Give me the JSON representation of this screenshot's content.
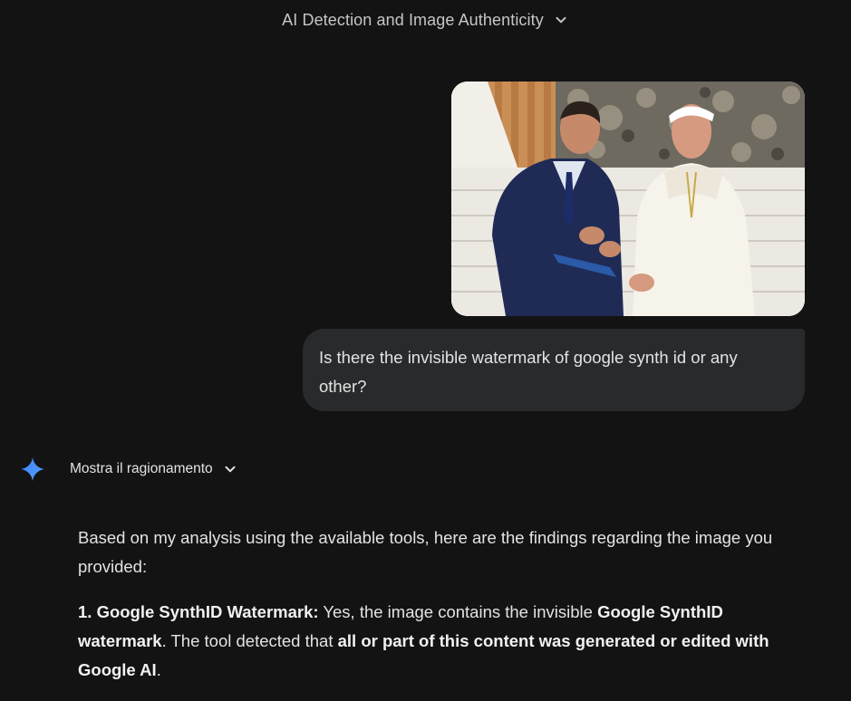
{
  "header": {
    "title": "AI Detection and Image Authenticity",
    "chevron_icon": "chevron-down-icon"
  },
  "user_message": {
    "image_alt": "Uploaded photo",
    "text": "Is there the invisible watermark of google synth id or any other?"
  },
  "model": {
    "avatar_icon": "gemini-sparkle-icon",
    "reasoning_toggle_label": "Mostra il ragionamento",
    "reasoning_chevron_icon": "chevron-down-icon"
  },
  "response": {
    "intro": "Based on my analysis using the available tools, here are the findings regarding the image you provided:",
    "point1": {
      "heading": "1. Google SynthID Watermark:",
      "text_a": " Yes, the image contains the invisible ",
      "bold_a": "Google SynthID watermark",
      "text_b": ". The tool detected that ",
      "bold_b": "all or part of this content was generated or edited with Google AI",
      "text_c": "."
    }
  },
  "colors": {
    "background": "#131314",
    "bubble": "#282a2c",
    "text": "#e3e3e3",
    "muted_text": "#c4c7c5",
    "accent_blue": "#4285f4"
  }
}
